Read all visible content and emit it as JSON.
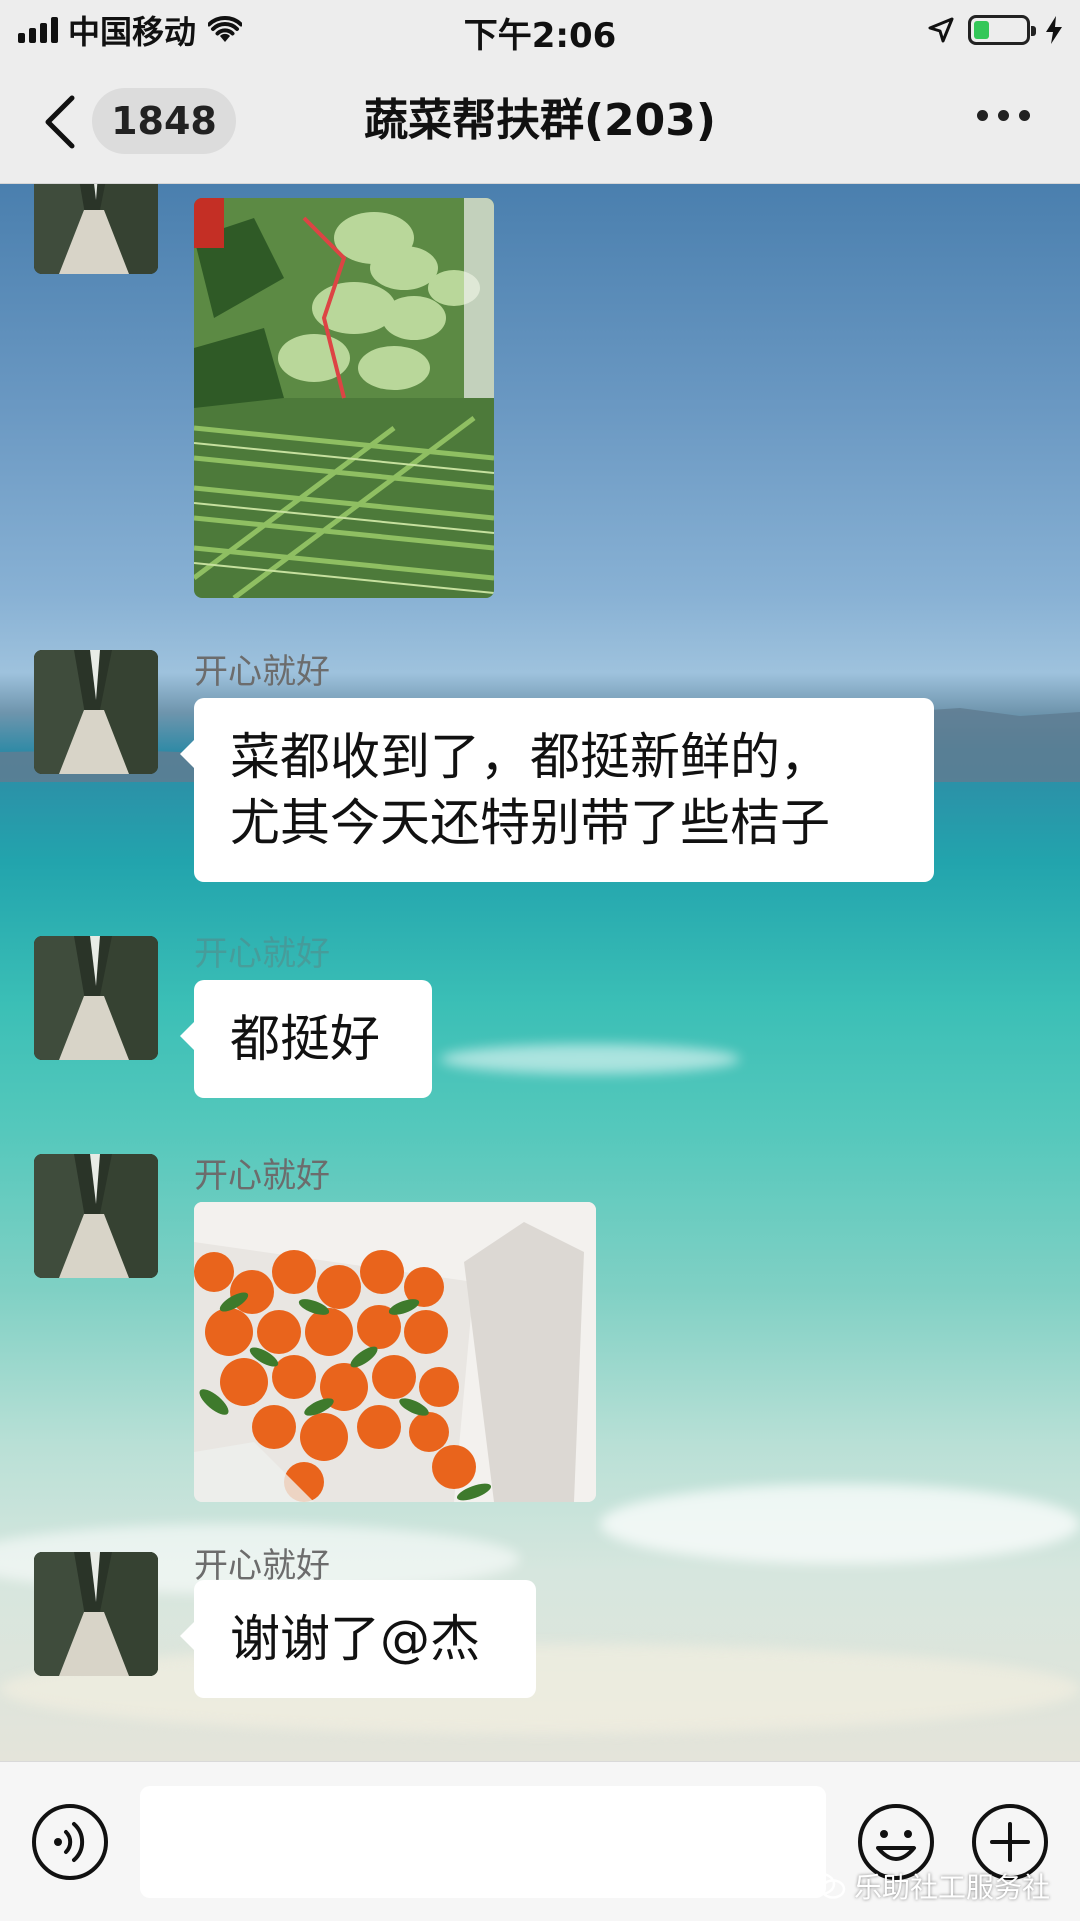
{
  "status_bar": {
    "carrier": "中国移动",
    "time": "下午2:06",
    "battery_level": 0.3,
    "icons": [
      "signal-bars-icon",
      "wifi-icon",
      "location-arrow-icon",
      "battery-icon",
      "charging-bolt-icon"
    ]
  },
  "nav": {
    "unread_count": "1848",
    "title": "蔬菜帮扶群(203)",
    "icons": [
      "chevron-left-icon",
      "more-dots-icon"
    ]
  },
  "messages": [
    {
      "type": "image",
      "content": "vegetables-photo"
    },
    {
      "type": "text",
      "sender": "开心就好",
      "lines": [
        "菜都收到了，都挺新鲜的，",
        "尤其今天还特别带了些桔子"
      ]
    },
    {
      "type": "text",
      "sender": "开心就好",
      "text": "都挺好"
    },
    {
      "type": "image",
      "sender": "开心就好",
      "content": "oranges-photo"
    },
    {
      "type": "text",
      "sender": "开心就好",
      "text": "谢谢了@杰"
    }
  ],
  "input_bar": {
    "icons": [
      "voice-icon",
      "emoji-icon",
      "plus-icon"
    ],
    "watermark": "乐助社工服务社"
  },
  "colors": {
    "bubble": "#ffffff",
    "nav_background": "#ededed",
    "battery_fill": "#34c759",
    "sender_name": "#6c6c6c"
  }
}
